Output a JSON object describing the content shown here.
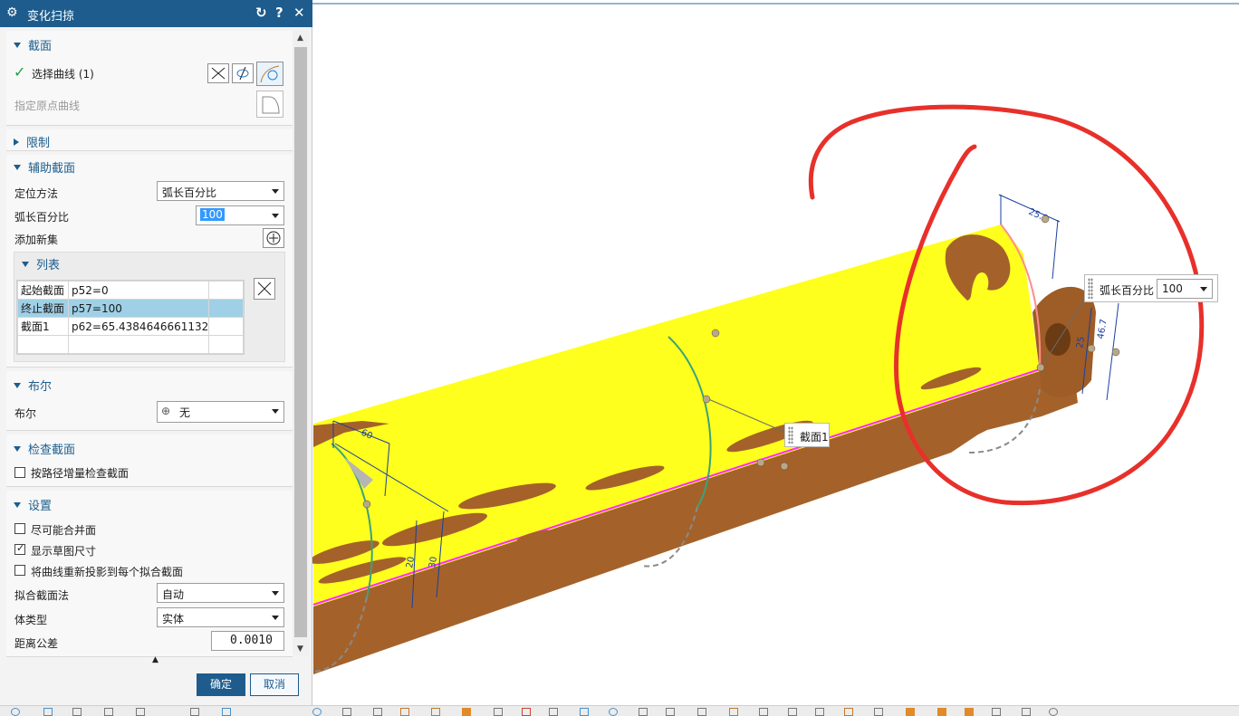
{
  "dialog": {
    "title": "变化扫掠",
    "buttons": {
      "reset": "↻",
      "help": "?",
      "close": "✕"
    },
    "section": {
      "header": "截面",
      "select_curve": "选择曲线 (1)",
      "origin_curve": "指定原点曲线"
    },
    "limit": {
      "header": "限制"
    },
    "aux_section": {
      "header": "辅助截面",
      "locate_method_label": "定位方法",
      "locate_method_value": "弧长百分比",
      "arc_percent_label": "弧长百分比",
      "arc_percent_value": "100",
      "add_set_label": "添加新集",
      "list_header": "列表",
      "rows": [
        {
          "name": "起始截面",
          "expr": "p52=0"
        },
        {
          "name": "终止截面",
          "expr": "p57=100"
        },
        {
          "name": "截面1",
          "expr": "p62=65.4384646661132"
        }
      ]
    },
    "boolean": {
      "header": "布尔",
      "label": "布尔",
      "value": "无"
    },
    "check_section": {
      "header": "检查截面",
      "option": "按路径增量检查截面"
    },
    "settings": {
      "header": "设置",
      "merge_faces": "尽可能合并面",
      "show_sketch_dims": "显示草图尺寸",
      "reproject": "将曲线重新投影到每个拟合截面",
      "fit_method_label": "拟合截面法",
      "fit_method_value": "自动",
      "body_type_label": "体类型",
      "body_type_value": "实体",
      "tolerance_label": "距离公差",
      "tolerance_value": "0.0010"
    },
    "ok": "确定",
    "cancel": "取消"
  },
  "viewport": {
    "section_tag": "截面1",
    "arc_label": "弧长百分比",
    "arc_value": "100",
    "dims": [
      "25.8",
      "46.7",
      "25",
      "60",
      "20",
      "30"
    ]
  },
  "colors": {
    "titlebar": "#1d5c8d",
    "accent": "#1b5e8e",
    "surface_yellow": "#ffff1e",
    "body_brown": "#a4622a",
    "highlight_red": "#e8302a"
  }
}
